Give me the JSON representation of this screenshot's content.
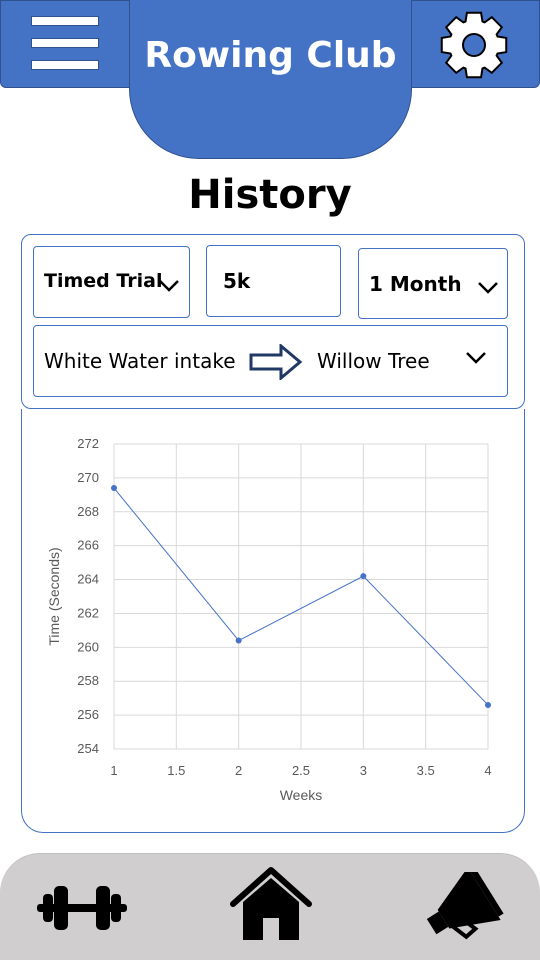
{
  "header": {
    "title": "Rowing Club",
    "menu_icon": "hamburger-menu-icon",
    "settings_icon": "gear-icon",
    "accent_color": "#4472c4",
    "border_color": "#2f528f"
  },
  "page": {
    "title": "History"
  },
  "filters": {
    "event_type": "Timed Trial",
    "distance": "5k",
    "period": "1 Month",
    "route_from": "White Water intake",
    "route_to": "Willow Tree",
    "route_arrow_icon": "arrow-right-icon"
  },
  "chart_data": {
    "type": "line",
    "xlabel": "Weeks",
    "ylabel": "Time (Seconds)",
    "x": [
      1,
      2,
      3,
      4
    ],
    "series": [
      {
        "values": [
          269.4,
          260.4,
          264.2,
          256.6
        ]
      }
    ],
    "xlim": [
      1,
      4
    ],
    "ylim": [
      254,
      272
    ],
    "x_ticks": [
      "1",
      "1.5",
      "2",
      "2.5",
      "3",
      "3.5",
      "4"
    ],
    "y_ticks": [
      "254",
      "256",
      "258",
      "260",
      "262",
      "264",
      "266",
      "268",
      "270",
      "272"
    ],
    "grid": true,
    "line_color": "#4472c4"
  },
  "bottom_nav": {
    "items": [
      {
        "icon": "dumbbell-icon"
      },
      {
        "icon": "home-icon"
      },
      {
        "icon": "megaphone-icon"
      }
    ],
    "background": "#d0cece"
  }
}
